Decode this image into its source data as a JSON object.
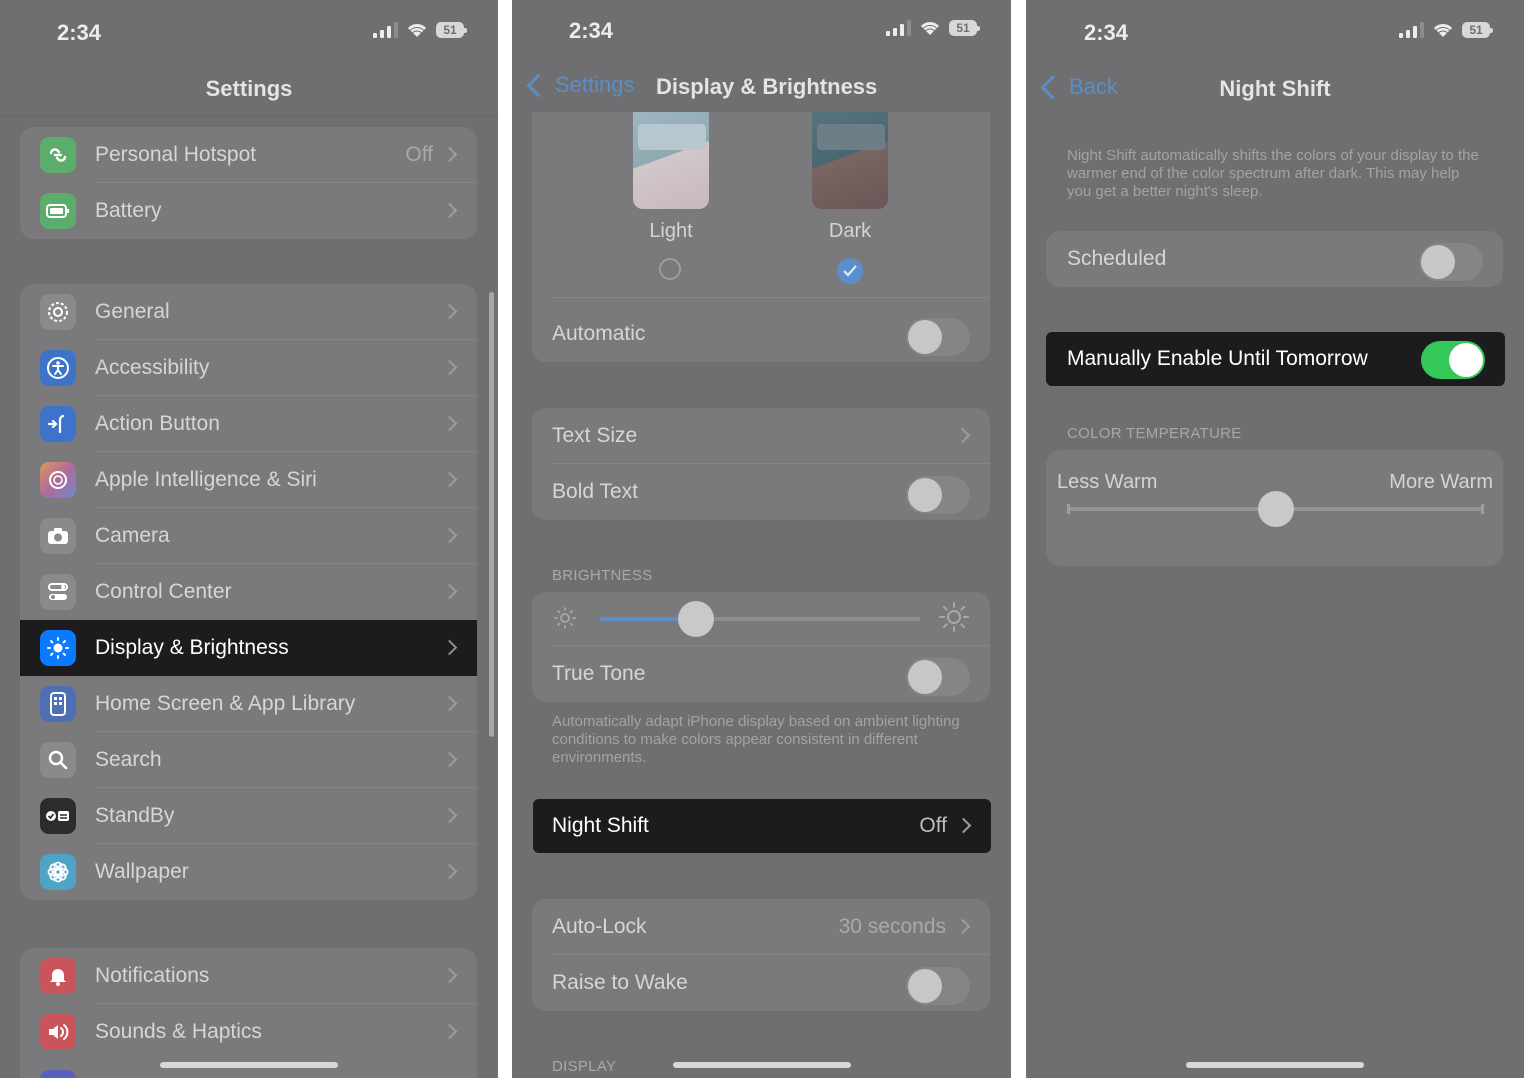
{
  "status": {
    "time": "2:34",
    "battery": "51"
  },
  "panel1": {
    "title": "Settings",
    "group1": [
      {
        "label": "Personal Hotspot",
        "value": "Off",
        "icon": "personal-hotspot-icon",
        "color": "#5cad6b"
      },
      {
        "label": "Battery",
        "value": "",
        "icon": "battery-icon",
        "color": "#5cad6b"
      }
    ],
    "group2": [
      {
        "label": "General",
        "icon": "gear-icon",
        "color": "#8a8a8c"
      },
      {
        "label": "Accessibility",
        "icon": "accessibility-icon",
        "color": "#3d74c9"
      },
      {
        "label": "Action Button",
        "icon": "action-button-icon",
        "color": "#3d74c9"
      },
      {
        "label": "Apple Intelligence & Siri",
        "icon": "siri-icon",
        "color": "#b06a9c"
      },
      {
        "label": "Camera",
        "icon": "camera-icon",
        "color": "#8a8a8c"
      },
      {
        "label": "Control Center",
        "icon": "control-center-icon",
        "color": "#8a8a8c"
      },
      {
        "label": "Display & Brightness",
        "icon": "sun-icon",
        "color": "#0a7aff"
      },
      {
        "label": "Home Screen & App Library",
        "icon": "home-screen-icon",
        "color": "#4f6fb5"
      },
      {
        "label": "Search",
        "icon": "search-icon",
        "color": "#8a8a8c"
      },
      {
        "label": "StandBy",
        "icon": "standby-icon",
        "color": "#2c2c2e"
      },
      {
        "label": "Wallpaper",
        "icon": "wallpaper-icon",
        "color": "#4fa3c4"
      }
    ],
    "group3": [
      {
        "label": "Notifications",
        "icon": "notifications-icon",
        "color": "#c9545a"
      },
      {
        "label": "Sounds & Haptics",
        "icon": "sounds-icon",
        "color": "#c9545a"
      }
    ]
  },
  "panel2": {
    "back": "Settings",
    "title": "Display & Brightness",
    "appearance": {
      "light": "Light",
      "dark": "Dark",
      "selected": "Dark"
    },
    "automatic": "Automatic",
    "text_size": "Text Size",
    "bold_text": "Bold Text",
    "brightness_header": "BRIGHTNESS",
    "brightness_level": 0.3,
    "true_tone": "True Tone",
    "true_tone_note": "Automatically adapt iPhone display based on ambient lighting conditions to make colors appear consistent in different environments.",
    "night_shift": {
      "label": "Night Shift",
      "value": "Off"
    },
    "auto_lock": {
      "label": "Auto-Lock",
      "value": "30 seconds"
    },
    "raise_to_wake": "Raise to Wake",
    "display_header": "DISPLAY"
  },
  "panel3": {
    "back": "Back",
    "title": "Night Shift",
    "description": "Night Shift automatically shifts the colors of your display to the warmer end of the color spectrum after dark. This may help you get a better night's sleep.",
    "scheduled": "Scheduled",
    "manual": "Manually Enable Until Tomorrow",
    "color_temp_header": "COLOR TEMPERATURE",
    "less_warm": "Less Warm",
    "more_warm": "More Warm",
    "temperature_level": 0.5
  }
}
